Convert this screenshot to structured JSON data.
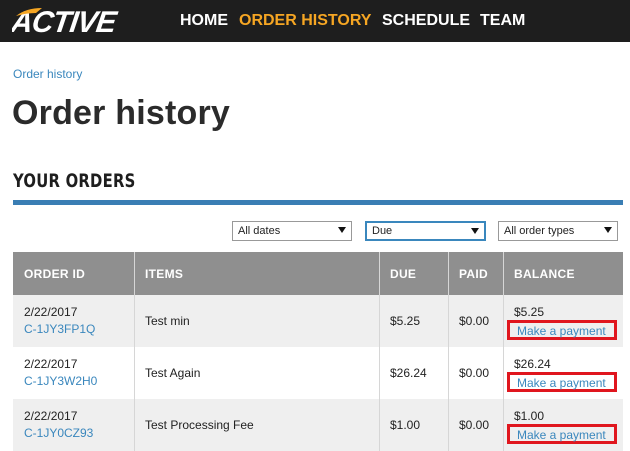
{
  "header": {
    "logo_text": "ACTIVE",
    "nav": [
      {
        "label": "HOME",
        "active": false
      },
      {
        "label": "ORDER HISTORY",
        "active": true
      },
      {
        "label": "SCHEDULE",
        "active": false
      },
      {
        "label": "TEAM",
        "active": false
      }
    ],
    "colors": {
      "bar": "#1e1e1e",
      "active": "#f6a623",
      "accent": "#3a7eb4"
    }
  },
  "breadcrumb": "Order history",
  "page_title": "Order history",
  "section_title": "YOUR ORDERS",
  "filters": {
    "dates": "All dates",
    "status": "Due",
    "types": "All order types"
  },
  "table": {
    "headers": [
      "ORDER ID",
      "ITEMS",
      "DUE",
      "PAID",
      "BALANCE"
    ],
    "rows": [
      {
        "date": "2/22/2017",
        "order_id": "C-1JY3FP1Q",
        "item": "Test min",
        "due": "$5.25",
        "paid": "$0.00",
        "balance": "$5.25",
        "action": "Make a payment"
      },
      {
        "date": "2/22/2017",
        "order_id": "C-1JY3W2H0",
        "item": "Test Again",
        "due": "$26.24",
        "paid": "$0.00",
        "balance": "$26.24",
        "action": "Make a payment"
      },
      {
        "date": "2/22/2017",
        "order_id": "C-1JY0CZ93",
        "item": "Test Processing Fee",
        "due": "$1.00",
        "paid": "$0.00",
        "balance": "$1.00",
        "action": "Make a payment"
      }
    ]
  }
}
